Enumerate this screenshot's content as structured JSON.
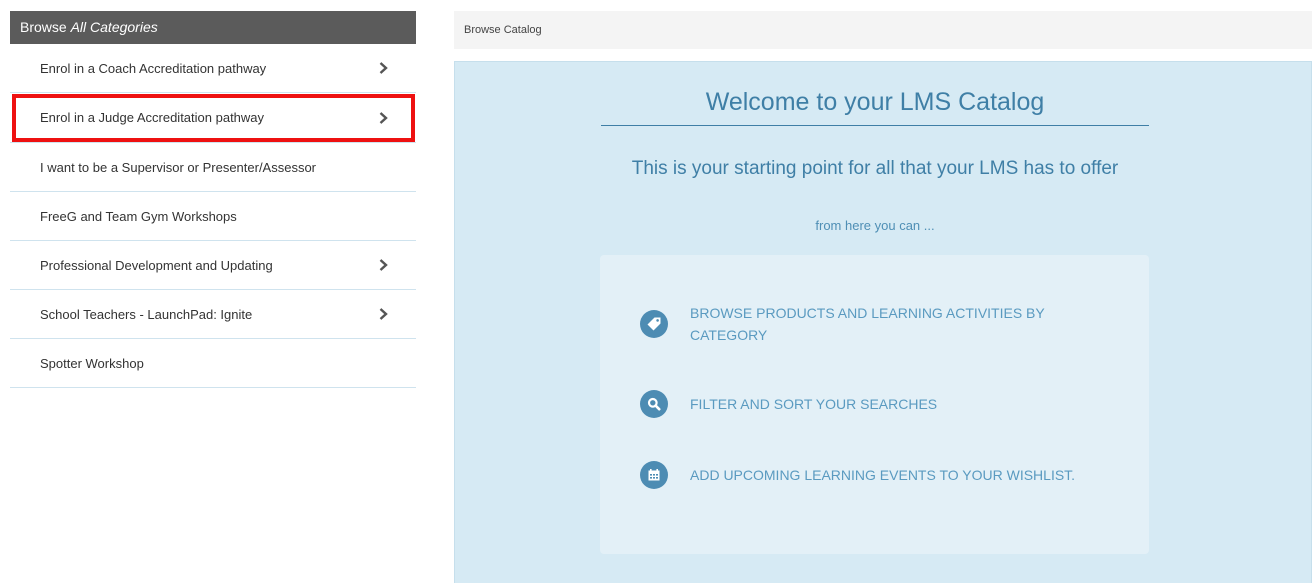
{
  "sidebar": {
    "header_prefix": "Browse ",
    "header_emphasis": "All Categories",
    "items": [
      {
        "label": "Enrol in a Coach Accreditation pathway",
        "has_children": true
      },
      {
        "label": "Enrol in a Judge Accreditation pathway",
        "has_children": true,
        "highlighted": true
      },
      {
        "label": "I want to be a Supervisor or Presenter/Assessor",
        "has_children": false
      },
      {
        "label": "FreeG and Team Gym Workshops",
        "has_children": false
      },
      {
        "label": "Professional Development and Updating",
        "has_children": true
      },
      {
        "label": "School Teachers - LaunchPad: Ignite",
        "has_children": true
      },
      {
        "label": "Spotter Workshop",
        "has_children": false
      }
    ]
  },
  "breadcrumb": {
    "label": "Browse Catalog"
  },
  "welcome": {
    "title": "Welcome to your LMS Catalog",
    "subtitle": "This is your starting point for all that your LMS has to offer",
    "note": "from here you can ...",
    "features": [
      {
        "icon": "tag-icon",
        "text": "BROWSE PRODUCTS AND LEARNING ACTIVITIES BY CATEGORY"
      },
      {
        "icon": "search-icon",
        "text": "FILTER AND SORT YOUR SEARCHES"
      },
      {
        "icon": "calendar-icon",
        "text": "ADD UPCOMING LEARNING EVENTS TO YOUR WISHLIST."
      }
    ]
  },
  "colors": {
    "sidebar_header_bg": "#5b5b5b",
    "panel_bg": "#d6eaf4",
    "accent": "#3f7fa6",
    "highlight_border": "#ee1111"
  }
}
